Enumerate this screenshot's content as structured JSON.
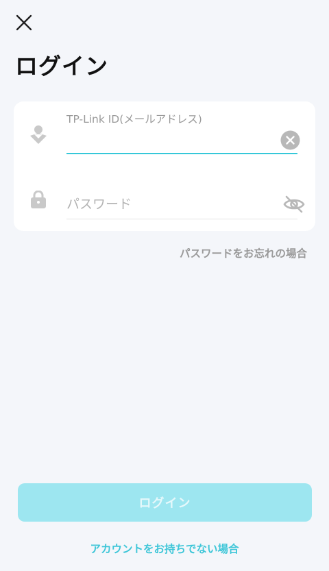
{
  "header": {
    "close_icon": "close-icon",
    "title": "ログイン"
  },
  "form": {
    "email": {
      "label": "TP-Link ID(メールアドレス)",
      "value": "",
      "icon": "user-icon",
      "clear_icon": "clear-circle-icon",
      "focused": true
    },
    "password": {
      "placeholder": "パスワード",
      "value": "",
      "icon": "lock-icon",
      "visibility_icon": "eye-off-icon"
    }
  },
  "links": {
    "forgot_password": "パスワードをお忘れの場合",
    "no_account": "アカウントをお持ちでない場合"
  },
  "actions": {
    "login_label": "ログイン",
    "login_enabled": false
  },
  "colors": {
    "accent": "#36c8d9",
    "button_disabled_bg": "#9de6f0",
    "link_accent": "#3ec6d8",
    "muted_text": "#9a9a9a",
    "background": "#f4f6fa",
    "card": "#ffffff"
  }
}
